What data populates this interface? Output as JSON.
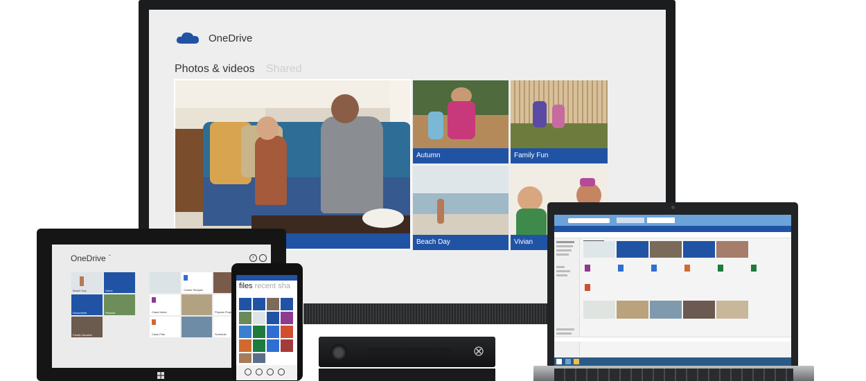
{
  "tv": {
    "app_name": "OneDrive",
    "tabs": [
      "Photos & videos",
      "Shared"
    ],
    "tiles": [
      {
        "caption": ""
      },
      {
        "caption": "Autumn"
      },
      {
        "caption": "Family Fun"
      },
      {
        "caption": "Beach Day"
      },
      {
        "caption": "Vivian"
      }
    ]
  },
  "tablet": {
    "app_name": "OneDrive",
    "items": [
      "Beach Day",
      "Home",
      "Documents",
      "Pictures",
      "Family Vacation",
      "Cookie Recipes",
      "Class Notes",
      "Physics Project",
      "Class Plan",
      "Schedule"
    ]
  },
  "phone": {
    "tabs": [
      "files",
      "recent",
      "sha"
    ]
  },
  "colors": {
    "accent": "#2153a5",
    "tv_screen": "#eeeeee",
    "bezel": "#1b1c1e"
  }
}
